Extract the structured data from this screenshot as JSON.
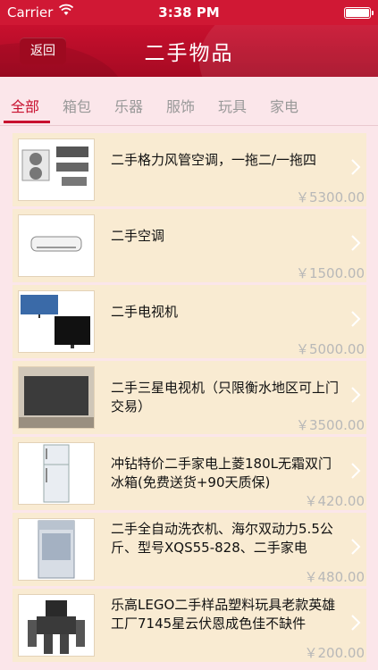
{
  "status_bar": {
    "carrier": "Carrier",
    "time": "3:38 PM"
  },
  "nav": {
    "back_label": "返回",
    "title": "二手物品"
  },
  "tabs": [
    {
      "label": "全部",
      "active": true
    },
    {
      "label": "箱包"
    },
    {
      "label": "乐器"
    },
    {
      "label": "服饰"
    },
    {
      "label": "玩具"
    },
    {
      "label": "家电"
    }
  ],
  "items": [
    {
      "title": "二手格力风管空调，一拖二/一拖四",
      "price": "￥5300.00",
      "thumb": "air-conditioner-units"
    },
    {
      "title": "二手空调",
      "price": "￥1500.00",
      "thumb": "wall-air-conditioner"
    },
    {
      "title": "二手电视机",
      "price": "￥5000.00",
      "thumb": "television-sets"
    },
    {
      "title": "二手三星电视机（只限衡水地区可上门交易）",
      "price": "￥3500.00",
      "thumb": "samsung-tv"
    },
    {
      "title": "冲钻特价二手家电上菱180L无霜双门冰箱(免费送货+90天质保)",
      "price": "￥420.00",
      "thumb": "refrigerator"
    },
    {
      "title": "二手全自动洗衣机、海尔双动力5.5公斤、型号XQS55-828、二手家电",
      "price": "￥480.00",
      "thumb": "washing-machine"
    },
    {
      "title": "乐高LEGO二手样品塑料玩具老款英雄工厂7145星云伏恩成色佳不缺件",
      "price": "￥200.00",
      "thumb": "lego-robot-toy"
    }
  ],
  "colors": {
    "brand_red": "#c8102e",
    "row_background": "#f9ebd2",
    "page_background": "#fbe6ea",
    "price_grey": "#b8b8b8"
  }
}
